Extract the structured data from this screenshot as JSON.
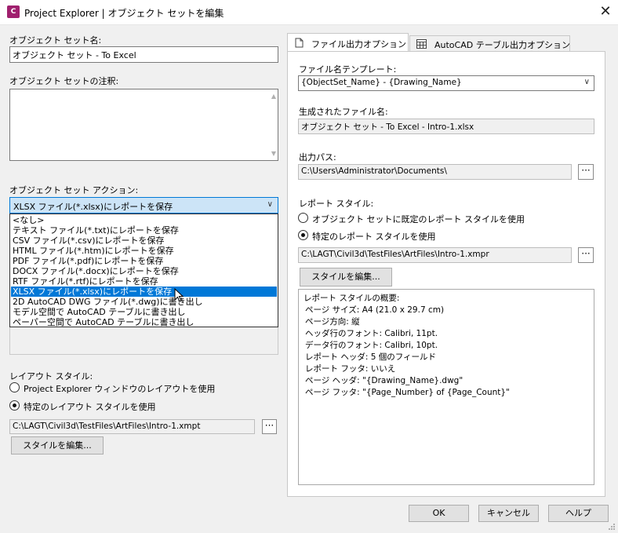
{
  "window": {
    "title": "Project Explorer | オブジェクト セットを編集",
    "app_icon_text": "C",
    "close_glyph": "✕"
  },
  "left": {
    "name_label": "オブジェクト セット名:",
    "name_value": "オブジェクト セット - To Excel",
    "notes_label": "オブジェクト セットの注釈:",
    "notes_value": "",
    "action_label": "オブジェクト セット アクション:",
    "action_selected": "XLSX ファイル(*.xlsx)にレポートを保存",
    "action_options": [
      "<なし>",
      "テキスト ファイル(*.txt)にレポートを保存",
      "CSV ファイル(*.csv)にレポートを保存",
      "HTML ファイル(*.htm)にレポートを保存",
      "PDF ファイル(*.pdf)にレポートを保存",
      "DOCX ファイル(*.docx)にレポートを保存",
      "RTF ファイル(*.rtf)にレポートを保存",
      "XLSX ファイル(*.xlsx)にレポートを保存",
      "2D AutoCAD DWG ファイル(*.dwg)に書き出し",
      "モデル空間で AutoCAD テーブルに書き出し",
      "ペーパー空間で AutoCAD テーブルに書き出し"
    ],
    "action_highlighted_index": 7,
    "layout_label": "レイアウト スタイル:",
    "layout_radio_1": "Project Explorer ウィンドウのレイアウトを使用",
    "layout_radio_2": "特定のレイアウト スタイルを使用",
    "layout_selected": 2,
    "layout_path": "C:\\LAGT\\Civil3d\\TestFiles\\ArtFiles\\Intro-1.xmpt",
    "browse_glyph": "···",
    "edit_style_button": "スタイルを編集..."
  },
  "tabs": [
    {
      "label": "ファイル出力オプション",
      "active": true,
      "icon": "document-icon"
    },
    {
      "label": "AutoCAD テーブル出力オプション",
      "active": false,
      "icon": "table-icon"
    }
  ],
  "right": {
    "template_label": "ファイル名テンプレート:",
    "template_value": "{ObjectSet_Name} - {Drawing_Name}",
    "generated_label": "生成されたファイル名:",
    "generated_value": "オブジェクト セット - To Excel - Intro-1.xlsx",
    "output_label": "出力パス:",
    "output_value": "C:\\Users\\Administrator\\Documents\\",
    "report_style_label": "レポート スタイル:",
    "report_radio_1": "オブジェクト セットに既定のレポート スタイルを使用",
    "report_radio_2": "特定のレポート スタイルを使用",
    "report_selected": 2,
    "report_path": "C:\\LAGT\\Civil3d\\TestFiles\\ArtFiles\\Intro-1.xmpr",
    "edit_style_button": "スタイルを編集...",
    "summary": [
      "レポート スタイルの概要:",
      "  ページ サイズ: A4 (21.0 x 29.7 cm)",
      "  ページ方向: 縦",
      "  ヘッダ行のフォント: Calibri, 11pt.",
      "  データ行のフォント: Calibri, 10pt.",
      "  レポート ヘッダ: 5 個のフィールド",
      "  レポート フッタ: いいえ",
      "  ページ ヘッダ: \"{Drawing_Name}.dwg\"",
      "  ページ フッタ: \"{Page_Number} of {Page_Count}\""
    ]
  },
  "footer": {
    "ok": "OK",
    "cancel": "キャンセル",
    "help": "ヘルプ"
  },
  "colors": {
    "selection": "#0078d7",
    "combo_focus": "#cce4f7",
    "app_icon": "#a0206e"
  }
}
